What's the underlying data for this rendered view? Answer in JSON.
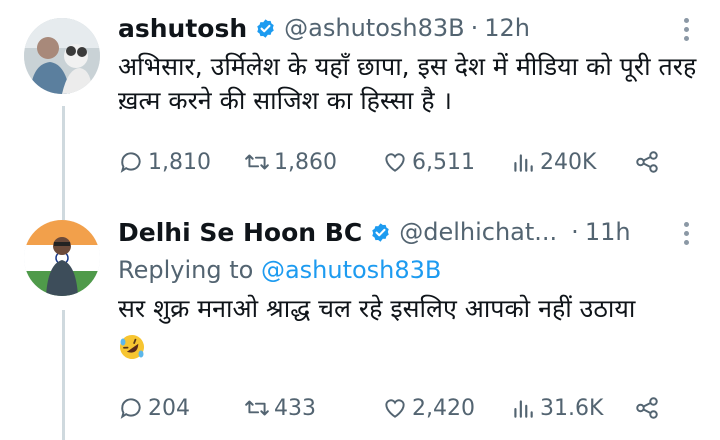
{
  "tweets": [
    {
      "name": "ashutosh",
      "handle": "@ashutosh83B",
      "sep": "·",
      "time": "12h",
      "text": "अभिसार, उर्मिलेश के यहाँ छापा, इस देश में मीडिया को पूरी तरह ख़त्म करने की साजिश का हिस्सा है ।",
      "replies": "1,810",
      "retweets": "1,860",
      "likes": "6,511",
      "views": "240K"
    },
    {
      "name": "Delhi Se Hoon BC",
      "handle": "@delhichat...",
      "sep": "·",
      "time": "11h",
      "replying_prefix": "Replying to",
      "replying_handle": "@ashutosh83B",
      "text": "सर शुक्र मनाओ श्राद्ध चल रहे इसलिए आपको नहीं उठाया",
      "emoji": "rolling-on-floor-laughing",
      "replies": "204",
      "retweets": "433",
      "likes": "2,420",
      "views": "31.6K"
    }
  ],
  "colors": {
    "accent": "#1d9bf0",
    "muted": "#536471",
    "text": "#0f1419"
  }
}
